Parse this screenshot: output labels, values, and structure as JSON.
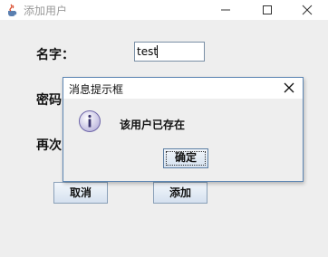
{
  "window": {
    "title": "添加用户",
    "icon": "java-coffee-icon"
  },
  "form": {
    "name_label": "名字：",
    "name_value": "test",
    "password_label": "密码",
    "confirm_label": "再次",
    "cancel_label": "取消",
    "add_label": "添加"
  },
  "dialog": {
    "title": "消息提示框",
    "icon": "info-icon",
    "message": "该用户已存在",
    "ok_label": "确定"
  },
  "colors": {
    "dialog_border": "#5d86b3",
    "button_gradient_top": "#f2f6fb",
    "button_gradient_bottom": "#d5e1ef"
  }
}
